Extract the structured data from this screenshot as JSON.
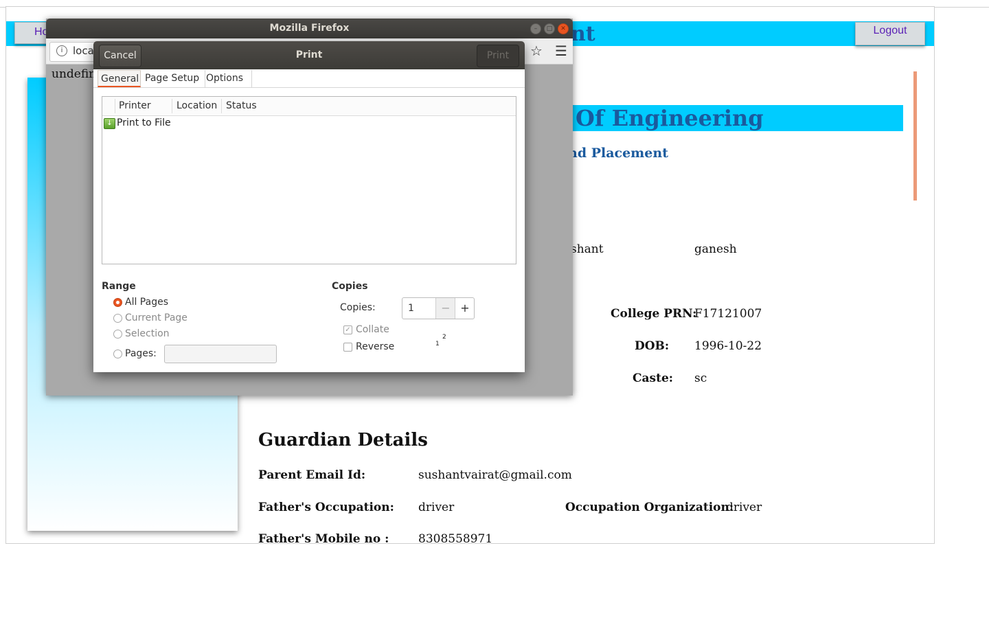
{
  "background_page": {
    "home_label": "Ho",
    "logout_label": "Logout",
    "title_fragment": "nt",
    "college_fragment": "Of Engineering",
    "placement_fragment": "nd Placement",
    "name_first_fragment": "shant",
    "name_last": "ganesh",
    "prn_label": "College PRN:",
    "prn_value": "F17121007",
    "dob_label": "DOB:",
    "dob_value": "1996-10-22",
    "caste_label": "Caste:",
    "caste_value": "sc",
    "guardian_heading": "Guardian Details",
    "parent_email_label": "Parent Email Id:",
    "parent_email_value": "sushantvairat@gmail.com",
    "father_occupation_label": "Father's Occupation:",
    "father_occupation_value": "driver",
    "occupation_org_label": "Occupation Organization:",
    "occupation_org_value": "driver",
    "father_mobile_label": "Father's Mobile no :",
    "father_mobile_value": "8308558971",
    "colors": {
      "accent_bar": "#00ccff",
      "heading_blue": "#1a5a9e",
      "orange_rule": "#ec9a78"
    }
  },
  "firefox": {
    "window_title": "Mozilla Firefox",
    "url_fragment": "loca",
    "content_text": "undefin",
    "icons": [
      "info-icon",
      "star-icon",
      "menu-icon",
      "minimize-icon",
      "maximize-icon",
      "close-icon"
    ]
  },
  "print_dialog": {
    "title": "Print",
    "cancel_label": "Cancel",
    "print_label": "Print",
    "tabs": [
      "General",
      "Page Setup",
      "Options"
    ],
    "active_tab": "General",
    "columns": [
      "Printer",
      "Location",
      "Status"
    ],
    "printers": [
      {
        "name": "Print to File",
        "icon": "print-to-file-icon"
      }
    ],
    "range": {
      "heading": "Range",
      "all_pages": "All Pages",
      "current_page": "Current Page",
      "selection": "Selection",
      "pages": "Pages:",
      "pages_value": "",
      "selected": "All Pages"
    },
    "copies": {
      "heading": "Copies",
      "label": "Copies:",
      "value": "1",
      "minus": "−",
      "plus": "+",
      "collate": "Collate",
      "collate_checked": true,
      "reverse": "Reverse",
      "reverse_checked": false,
      "preview_page_1": "1",
      "preview_page_2": "2"
    },
    "accent_color": "#e95420"
  }
}
